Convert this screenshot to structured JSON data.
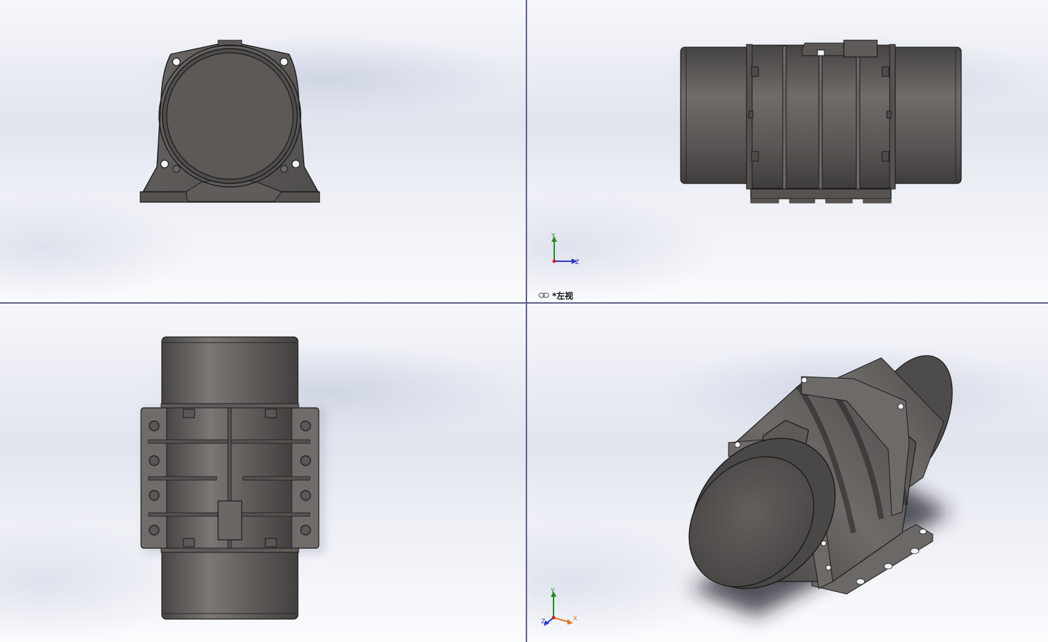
{
  "viewports": {
    "front": {
      "name": "front-view"
    },
    "left": {
      "name": "left-view",
      "label": "*左视"
    },
    "top": {
      "name": "top-view"
    },
    "iso": {
      "name": "isometric-view"
    }
  },
  "triad": {
    "left_axes": [
      "Y",
      "Z"
    ],
    "iso_axes": [
      "Y",
      "X",
      "Z"
    ]
  },
  "colors": {
    "body": "#5c5956",
    "body_dark": "#3a3836",
    "edge": "#1b1b1b",
    "axis_y": "#1f8a1f",
    "axis_z": "#2a35c9",
    "axis_x": "#d0201f",
    "divider": "#5d5f86"
  },
  "icons": {
    "view_link": "link-icon"
  }
}
